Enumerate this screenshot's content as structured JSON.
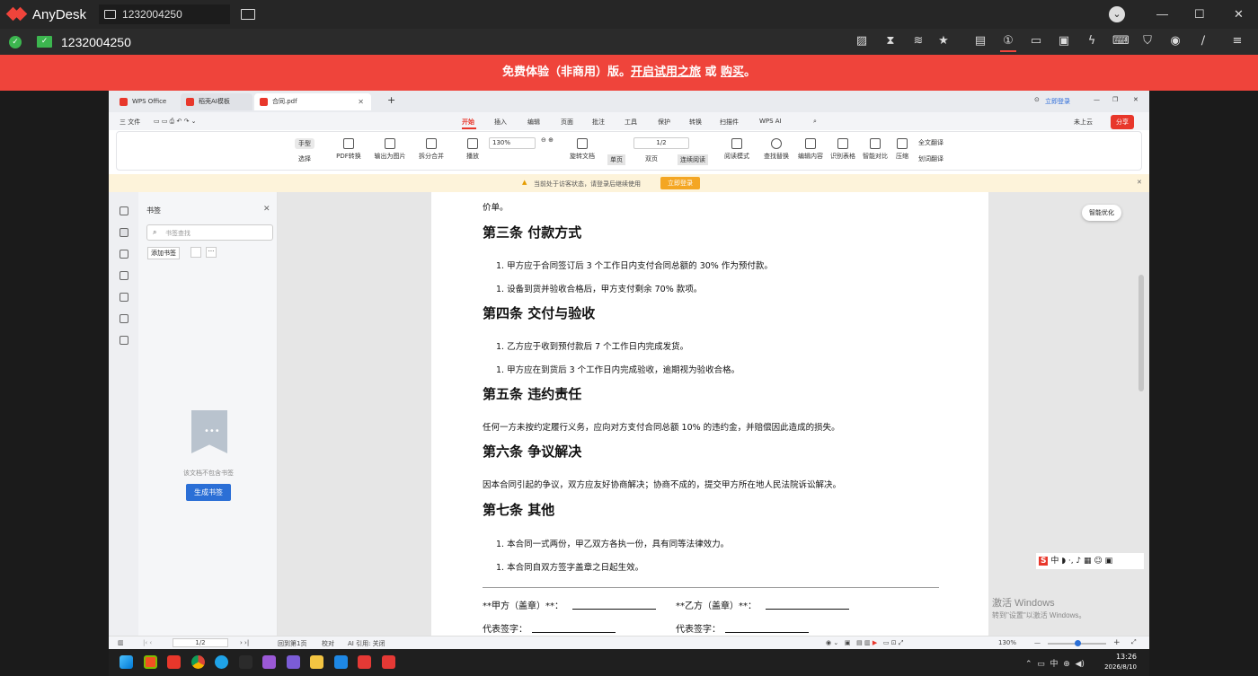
{
  "anydesk": {
    "app_name": "AnyDesk",
    "tab_id": "1232004250",
    "session_id": "1232004250",
    "chevron": "⌄",
    "win": {
      "min": "—",
      "max": "☐",
      "close": "✕"
    }
  },
  "trial": {
    "text1": "免费体验（非商用）版。",
    "link1": "开启试用之旅",
    "or": " 或 ",
    "link2": "购买",
    "end": "。"
  },
  "wps": {
    "tabs": [
      "WPS Office",
      "稻壳AI模板",
      "合同.pdf"
    ],
    "tab_icons": [
      "wps-logo-icon",
      "docer-icon",
      "pdf-icon"
    ],
    "new_tab": "+",
    "login": "立即登录",
    "menu_file": "三 文件",
    "menu": [
      "开始",
      "插入",
      "编辑",
      "页面",
      "批注",
      "工具",
      "保护",
      "转换",
      "扫描件",
      "WPS AI"
    ],
    "cloud": "未上云",
    "share": "分享",
    "ribbon": {
      "hand": "手型",
      "select": "选择",
      "pdf_convert": "PDF转换",
      "export_img": "输出为图片",
      "split_merge": "拆分合并",
      "play": "播放",
      "zoom": "130%",
      "page": "1/2",
      "rotate": "旋转文档",
      "single": "单页",
      "double": "双页",
      "continuous": "连续阅读",
      "read_mode": "阅读模式",
      "find": "查找替换",
      "edit": "编辑内容",
      "ocr": "识别表格",
      "compare": "智能对比",
      "compress": "压缩",
      "translate_all": "全文翻译",
      "translate_word": "划词翻译"
    },
    "notice": "当前处于访客状态，请登录后继续使用",
    "notice_btn": "立即登录",
    "bookmark": {
      "title": "书签",
      "search_placeholder": "书签查找",
      "add": "添加书签",
      "empty": "该文档不包含书签",
      "generate": "生成书签"
    },
    "smart": "智能优化",
    "status": {
      "page": "1/2",
      "back": "回到第1页",
      "proofread": "校对",
      "ai": "AI 引用: 关闭",
      "zoom": "130%"
    }
  },
  "doc": {
    "top_fragment": "价单。",
    "sections": [
      {
        "title": "第三条  付款方式",
        "items": [
          "1.   甲方应于合同签订后 3 个工作日内支付合同总额的 30% 作为预付款。",
          "1.   设备到货并验收合格后，甲方支付剩余 70% 款项。"
        ]
      },
      {
        "title": "第四条  交付与验收",
        "items": [
          "1.   乙方应于收到预付款后 7 个工作日内完成发货。",
          "1.   甲方应在到货后 3 个工作日内完成验收，逾期视为验收合格。"
        ]
      },
      {
        "title": "第五条  违约责任",
        "para": "任何一方未按约定履行义务，应向对方支付合同总额 10% 的违约金，并赔偿因此造成的损失。"
      },
      {
        "title": "第六条  争议解决",
        "para": "因本合同引起的争议，双方应友好协商解决；协商不成的，提交甲方所在地人民法院诉讼解决。"
      },
      {
        "title": "第七条  其他",
        "items": [
          "1.   本合同一式两份，甲乙双方各执一份，具有同等法律效力。",
          "1.   本合同自双方签字盖章之日起生效。"
        ]
      }
    ],
    "sig_a": "**甲方（盖章）**：",
    "sig_b": "**乙方（盖章）**：",
    "rep_a": "代表签字：",
    "rep_b": "代表签字："
  },
  "windows": {
    "watermark1": "激活 Windows",
    "watermark2": "转到\"设置\"以激活 Windows。",
    "ime": "中",
    "time": "13:26",
    "date": "2026/8/10"
  },
  "colors": {
    "anydesk_red": "#ef443b",
    "wps_accent": "#e8372b",
    "ok_green": "#3cb64f"
  }
}
